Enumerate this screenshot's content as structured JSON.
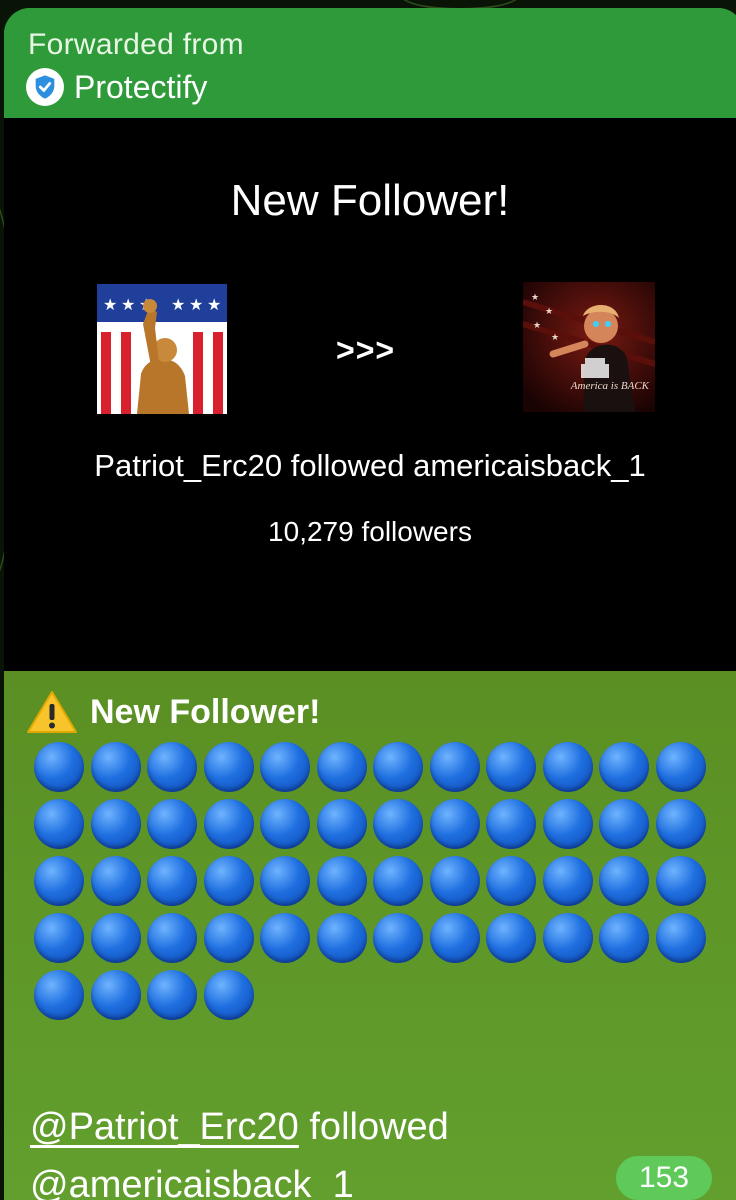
{
  "forward": {
    "label": "Forwarded from",
    "source_name": "Protectify",
    "source_icon": "shield-check-icon"
  },
  "media": {
    "title": "New Follower!",
    "arrows": ">>>",
    "left_avatar_icon": "patriot-avatar",
    "right_avatar_icon": "america-is-back-avatar",
    "right_avatar_caption": "America is BACK",
    "follow_line": "Patriot_Erc20 followed americaisback_1",
    "followers": "10,279 followers"
  },
  "message": {
    "heading_icon": "warning-icon",
    "heading": "New Follower!",
    "dot_icon": "blue-circle-emoji",
    "dot_count": 52,
    "follower_handle": "@Patriot_Erc20",
    "followed_word": "followed",
    "followed_handle": "@americaisback_1"
  },
  "views": "153",
  "colors": {
    "header_green": "#2f9a3a",
    "message_green": "#5f9126",
    "badge_green": "#5fca5a",
    "dot_blue": "#1f6fe0"
  }
}
